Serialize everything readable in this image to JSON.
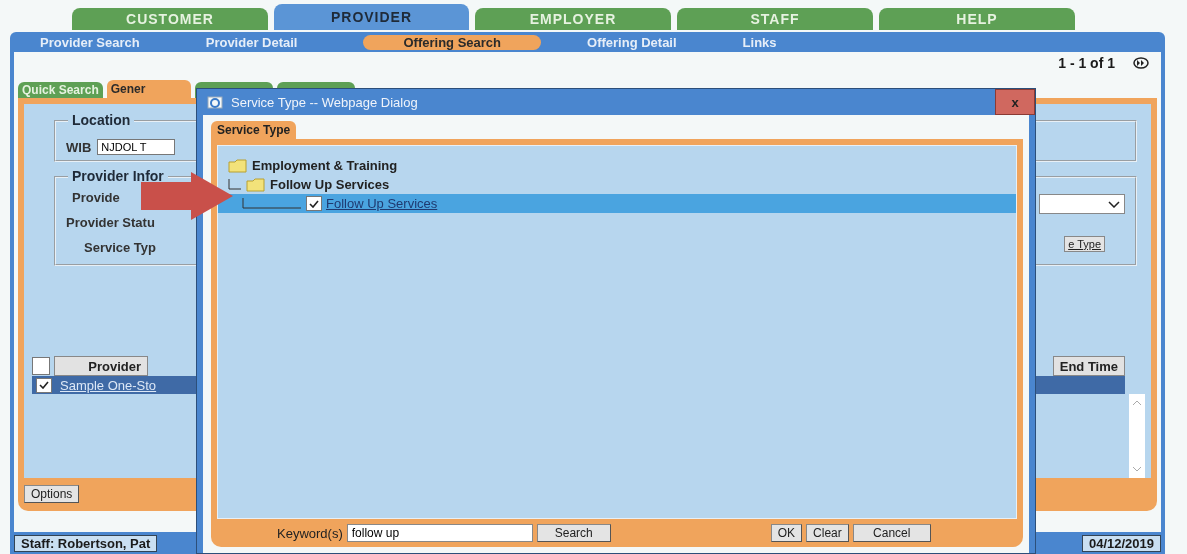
{
  "top_tabs": [
    {
      "label": "CUSTOMER",
      "selected": false
    },
    {
      "label": "PROVIDER",
      "selected": true
    },
    {
      "label": "EMPLOYER",
      "selected": false
    },
    {
      "label": "STAFF",
      "selected": false
    },
    {
      "label": "HELP",
      "selected": false
    }
  ],
  "nav": [
    {
      "label": "Provider Search",
      "selected": false
    },
    {
      "label": "Provider Detail",
      "selected": false
    },
    {
      "label": "Offering Search",
      "selected": true
    },
    {
      "label": "Offering Detail",
      "selected": false
    },
    {
      "label": "Links",
      "selected": false
    }
  ],
  "pager": {
    "range": "1 - 1 of 1"
  },
  "sub_tabs": [
    {
      "label": "Quick Search",
      "selected": false
    },
    {
      "label": "Gener",
      "selected": true
    },
    {
      "selected": false
    },
    {
      "selected": false
    }
  ],
  "location": {
    "legend": "Location",
    "wib_label": "WIB",
    "wib_value": "NJDOL T"
  },
  "provider_info": {
    "legend": "Provider Infor",
    "labels": [
      "Provide",
      "Provider Statu",
      "Service Typ"
    ],
    "service_type_button": "e Type"
  },
  "table": {
    "header_checked": false,
    "columns": [
      "Provider",
      "End Time"
    ],
    "rows": [
      {
        "cell": "Sample One-Sto",
        "checked": true,
        "selected": true
      }
    ]
  },
  "options_button": "Options",
  "status_bar": {
    "staff": "Staff: Robertson, Pat",
    "date": "04/12/2019"
  },
  "dialog": {
    "title": "Service Type -- Webpage Dialog",
    "close_label": "x",
    "tab": "Service Type",
    "tree": [
      {
        "label": "Employment & Training",
        "kind": "folder",
        "children": [
          {
            "label": "Follow Up Services",
            "kind": "folder",
            "children": [
              {
                "label": "Follow Up Services",
                "kind": "leaf",
                "checked": true,
                "selected": true
              }
            ]
          }
        ]
      }
    ],
    "keyword_label": "Keyword(s)",
    "keyword_value": "follow up",
    "search_button": "Search",
    "buttons": [
      "OK",
      "Clear",
      "Cancel"
    ]
  }
}
